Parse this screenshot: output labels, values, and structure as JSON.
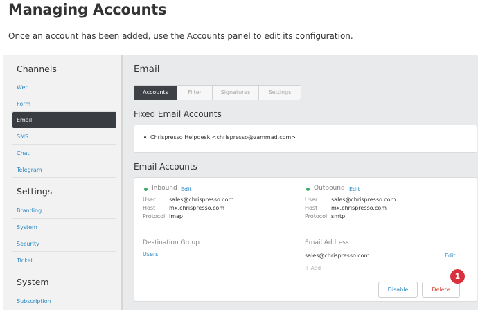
{
  "doc": {
    "title": "Managing Accounts",
    "intro": "Once an account has been added, use the Accounts panel to edit its configuration."
  },
  "sidebar": {
    "sections": [
      {
        "heading": "Channels",
        "items": [
          "Web",
          "Form",
          "Email",
          "SMS",
          "Chat",
          "Telegram"
        ]
      },
      {
        "heading": "Settings",
        "items": [
          "Branding",
          "System",
          "Security",
          "Ticket"
        ]
      },
      {
        "heading": "System",
        "items": [
          "Subscription"
        ]
      }
    ],
    "active": "Email"
  },
  "main": {
    "title": "Email",
    "tabs": [
      "Accounts",
      "Filter",
      "Signatures",
      "Settings"
    ],
    "active_tab": "Accounts",
    "fixed": {
      "title": "Fixed Email Accounts",
      "items": [
        "Chrispresso Helpdesk <chrispresso@zammad.com>"
      ]
    },
    "accounts": {
      "title": "Email Accounts",
      "inbound": {
        "label": "Inbound",
        "edit": "Edit",
        "status_color": "#38ad69",
        "rows": [
          {
            "key": "User",
            "value": "sales@chrispresso.com"
          },
          {
            "key": "Host",
            "value": "mx.chrispresso.com"
          },
          {
            "key": "Protocol",
            "value": "imap"
          }
        ]
      },
      "outbound": {
        "label": "Outbound",
        "edit": "Edit",
        "status_color": "#38ad69",
        "rows": [
          {
            "key": "User",
            "value": "sales@chrispresso.com"
          },
          {
            "key": "Host",
            "value": "mx.chrispresso.com"
          },
          {
            "key": "Protocol",
            "value": "smtp"
          }
        ]
      },
      "destination": {
        "label": "Destination Group",
        "value": "Users"
      },
      "email_address": {
        "label": "Email Address",
        "value": "sales@chrispresso.com",
        "edit": "Edit",
        "add": "+ Add"
      },
      "buttons": {
        "disable": "Disable",
        "delete": "Delete"
      }
    }
  },
  "annotation": {
    "badge": "1",
    "color": "#d9303e"
  }
}
